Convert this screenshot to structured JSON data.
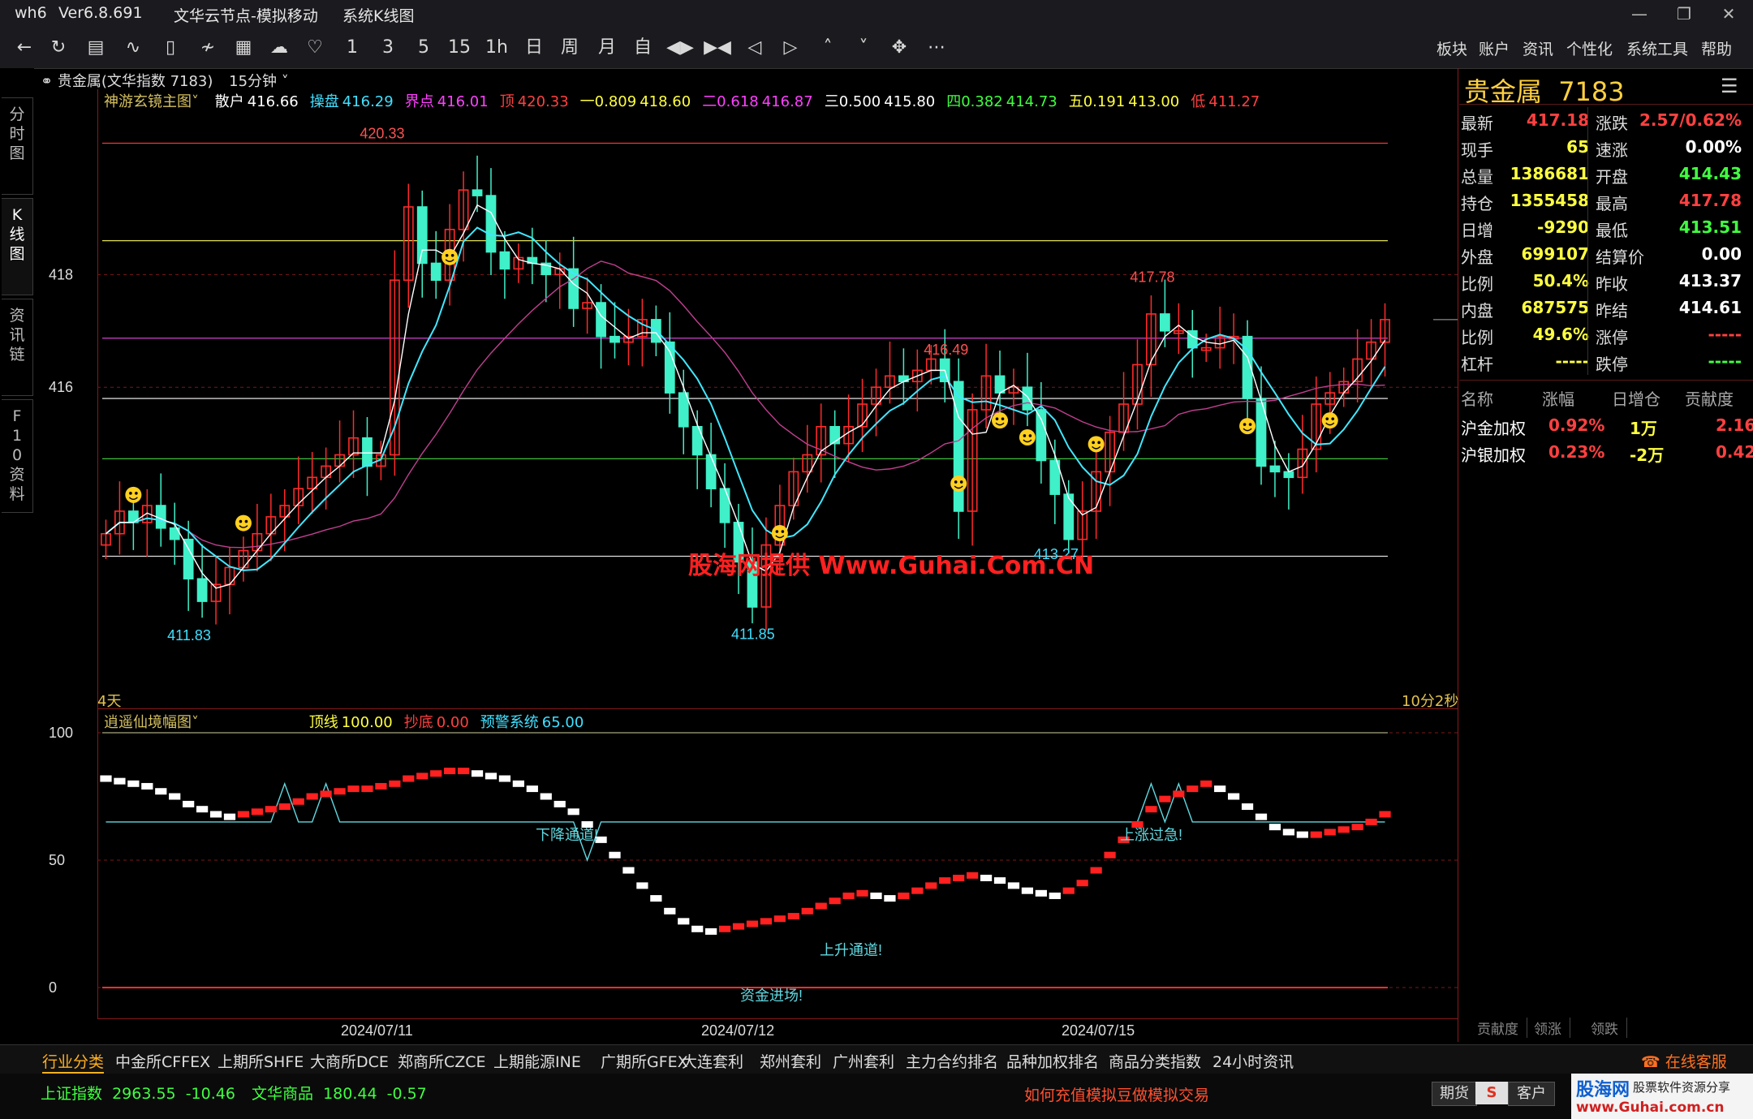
{
  "window": {
    "app": "wh6",
    "version": "Ver6.8.691",
    "node": "文华云节点-模拟移动",
    "view": "系统K线图"
  },
  "toolbar": {
    "icons": [
      "back-icon",
      "refresh-icon",
      "list-icon",
      "line-chart-icon",
      "kline-icon",
      "draw-icon",
      "calc-icon",
      "cloud-icon",
      "bell-icon"
    ],
    "periods": [
      "1",
      "3",
      "5",
      "15",
      "1h",
      "日",
      "周",
      "月",
      "自"
    ],
    "menu": [
      "板块",
      "账户",
      "资讯",
      "个性化",
      "系统工具",
      "帮助"
    ]
  },
  "left_tabs": [
    "分时图",
    "K线图",
    "资讯链",
    "F10资料"
  ],
  "chart_header": {
    "symbol": "贵金属(文华指数 7183)",
    "period": "15分钟",
    "indicator_name": "神游玄镜主图",
    "items": [
      {
        "label": "散户",
        "value": "416.66",
        "color": "#ffffff"
      },
      {
        "label": "操盘",
        "value": "416.29",
        "color": "#40e0ff"
      },
      {
        "label": "界点",
        "value": "416.01",
        "color": "#ff40ff"
      },
      {
        "label": "顶",
        "value": "420.33",
        "color": "#ff4040"
      },
      {
        "label": "一0.809",
        "value": "418.60",
        "color": "#ffff40"
      },
      {
        "label": "二0.618",
        "value": "416.87",
        "color": "#ff40ff"
      },
      {
        "label": "三0.500",
        "value": "415.80",
        "color": "#ffffff"
      },
      {
        "label": "四0.382",
        "value": "414.73",
        "color": "#40ff40"
      },
      {
        "label": "五0.191",
        "value": "413.00",
        "color": "#ffff40"
      },
      {
        "label": "低",
        "value": "411.27",
        "color": "#ff4040"
      }
    ],
    "days_label": "4天",
    "countdown": "10分2秒"
  },
  "sub_header": {
    "indicator_name": "逍遥仙境幅图",
    "items": [
      {
        "label": "顶线",
        "value": "100.00",
        "color": "#ffff40"
      },
      {
        "label": "抄底",
        "value": "0.00",
        "color": "#ff4040"
      },
      {
        "label": "预警系统",
        "value": "65.00",
        "color": "#40e0ff"
      }
    ],
    "annotations": [
      "下降通道!",
      "上升通道!",
      "上涨过急!",
      "资金进场!"
    ]
  },
  "watermark": "股海网提供 Www.Guhai.Com.CN",
  "chart_data": [
    {
      "type": "candlestick",
      "name": "main",
      "ylim": [
        410.3,
        421.0
      ],
      "yticks": [
        418.0,
        416.0
      ],
      "xticks": [
        "2024/07/11",
        "2024/07/12",
        "2024/07/15"
      ],
      "fib_levels": [
        {
          "value": 420.33,
          "color": "#ff3030"
        },
        {
          "value": 418.6,
          "color": "#e0e050"
        },
        {
          "value": 416.87,
          "color": "#d040d0"
        },
        {
          "value": 415.8,
          "color": "#ffffff"
        },
        {
          "value": 414.73,
          "color": "#40c040"
        },
        {
          "value": 413.0,
          "color": "#e0e0e0"
        }
      ],
      "annotations": [
        {
          "text": "420.33",
          "i": 20,
          "v": 420.33,
          "color": "#ff5050"
        },
        {
          "text": "411.83",
          "i": 6,
          "v": 411.83,
          "color": "#40e0ff"
        },
        {
          "text": "411.85",
          "i": 47,
          "v": 411.85,
          "color": "#40e0ff"
        },
        {
          "text": "416.49",
          "i": 61,
          "v": 416.49,
          "color": "#ff5050"
        },
        {
          "text": "413.27",
          "i": 69,
          "v": 413.27,
          "color": "#40e0ff"
        },
        {
          "text": "417.78",
          "i": 76,
          "v": 417.78,
          "color": "#ff5050"
        }
      ],
      "closes": [
        413.4,
        413.8,
        413.6,
        413.9,
        413.5,
        413.3,
        412.6,
        412.2,
        412.5,
        412.8,
        413.1,
        413.4,
        413.7,
        413.9,
        414.2,
        414.4,
        414.6,
        414.8,
        415.1,
        414.6,
        414.8,
        417.9,
        419.2,
        418.2,
        417.9,
        418.8,
        419.5,
        419.4,
        418.4,
        418.1,
        418.3,
        418.2,
        418.0,
        418.1,
        417.4,
        417.5,
        416.9,
        416.8,
        416.9,
        417.2,
        416.8,
        415.9,
        415.3,
        414.8,
        414.2,
        413.6,
        412.9,
        412.1,
        413.2,
        413.9,
        414.5,
        414.8,
        415.3,
        415.0,
        415.3,
        415.7,
        416.0,
        416.2,
        416.1,
        416.3,
        416.5,
        416.1,
        413.8,
        415.6,
        416.2,
        415.9,
        416.0,
        415.6,
        414.7,
        414.1,
        413.3,
        413.8,
        414.5,
        415.2,
        415.7,
        416.4,
        417.3,
        417.0,
        417.0,
        416.7,
        416.7,
        416.9,
        416.9,
        415.8,
        414.6,
        414.5,
        414.4,
        414.9,
        415.7,
        415.9,
        416.1,
        416.5,
        416.8,
        417.2
      ]
    },
    {
      "type": "step-line",
      "name": "sub",
      "ylim": [
        0,
        100
      ],
      "yticks": [
        100.0,
        50.0,
        0.0
      ],
      "ref_lines": [
        100,
        65,
        0
      ],
      "values": [
        82,
        81,
        80,
        79,
        77,
        75,
        72,
        70,
        68,
        67,
        68,
        69,
        70,
        71,
        73,
        75,
        76,
        77,
        78,
        78,
        79,
        80,
        82,
        83,
        84,
        85,
        85,
        84,
        83,
        82,
        80,
        78,
        75,
        72,
        69,
        64,
        58,
        52,
        46,
        40,
        35,
        30,
        26,
        23,
        22,
        23,
        24,
        25,
        26,
        27,
        28,
        30,
        32,
        34,
        36,
        37,
        36,
        35,
        36,
        38,
        40,
        42,
        43,
        44,
        43,
        42,
        40,
        38,
        37,
        36,
        38,
        41,
        46,
        52,
        58,
        64,
        70,
        74,
        76,
        78,
        80,
        78,
        75,
        71,
        67,
        63,
        61,
        60,
        60,
        61,
        62,
        63,
        65,
        68
      ]
    }
  ],
  "quote_panel": {
    "title_name": "贵金属",
    "title_code": "7183",
    "rows": [
      {
        "l1": "最新",
        "v1": "417.18",
        "c1": "#ff4040",
        "l2": "涨跌",
        "v2": "2.57/0.62%",
        "c2": "#ff4040"
      },
      {
        "l1": "现手",
        "v1": "65",
        "c1": "#ffff40",
        "l2": "速涨",
        "v2": "0.00%",
        "c2": "#ffffff"
      },
      {
        "l1": "总量",
        "v1": "1386681",
        "c1": "#ffff40",
        "l2": "开盘",
        "v2": "414.43",
        "c2": "#40ff40"
      },
      {
        "l1": "持仓",
        "v1": "1355458",
        "c1": "#ffff40",
        "l2": "最高",
        "v2": "417.78",
        "c2": "#ff4040"
      },
      {
        "l1": "日增",
        "v1": "-9290",
        "c1": "#ffff40",
        "l2": "最低",
        "v2": "413.51",
        "c2": "#40ff40"
      },
      {
        "l1": "外盘",
        "v1": "699107",
        "c1": "#ffff40",
        "l2": "结算价",
        "v2": "0.00",
        "c2": "#ffffff"
      },
      {
        "l1": "比例",
        "v1": "50.4%",
        "c1": "#ffff40",
        "l2": "昨收",
        "v2": "413.37",
        "c2": "#ffffff"
      },
      {
        "l1": "内盘",
        "v1": "687575",
        "c1": "#ffff40",
        "l2": "昨结",
        "v2": "414.61",
        "c2": "#ffffff"
      },
      {
        "l1": "比例",
        "v1": "49.6%",
        "c1": "#ffff40",
        "l2": "涨停",
        "v2": "-----",
        "c2": "#ff4040"
      },
      {
        "l1": "杠杆",
        "v1": "-----",
        "c1": "#ffff40",
        "l2": "跌停",
        "v2": "-----",
        "c2": "#40ff40"
      }
    ],
    "table_headers": [
      "名称",
      "涨幅",
      "日增仓",
      "贡献度"
    ],
    "table_rows": [
      {
        "name": "沪金加权",
        "chg": "0.92%",
        "inc": "1万",
        "contrib": "2.16"
      },
      {
        "name": "沪银加权",
        "chg": "0.23%",
        "inc": "-2万",
        "contrib": "0.42"
      }
    ],
    "bottom_tabs": [
      "贡献度",
      "领涨",
      "领跌"
    ]
  },
  "bottom_tabs": [
    "行业分类",
    "中金所CFFEX",
    "上期所SHFE",
    "大商所DCE",
    "郑商所CZCE",
    "上期能源INE",
    "广期所GFEX",
    "大连套利",
    "郑州套利",
    "广州套利",
    "主力合约排名",
    "品种加权排名",
    "商品分类指数",
    "24小时资讯"
  ],
  "online_service": "在线客服",
  "status": {
    "idx1_name": "上证指数",
    "idx1_val": "2963.55",
    "idx1_chg": "-10.46",
    "idx2_name": "文华商品",
    "idx2_val": "180.44",
    "idx2_chg": "-0.57",
    "promo": "如何充值模拟豆做模拟交易",
    "btn1": "期货",
    "btn2": "客户",
    "logo_text": "股海网",
    "logo_sub": "股票软件资源分享",
    "logo_url": "www.Guhai.com.cn"
  },
  "colors": {
    "up": "#ff2a2a",
    "down": "#3ff0c8",
    "fast_ma": "#ffffff",
    "mid_ma": "#40e8ff",
    "slow_ma": "#c04090",
    "grid": "#8b1a1a"
  }
}
